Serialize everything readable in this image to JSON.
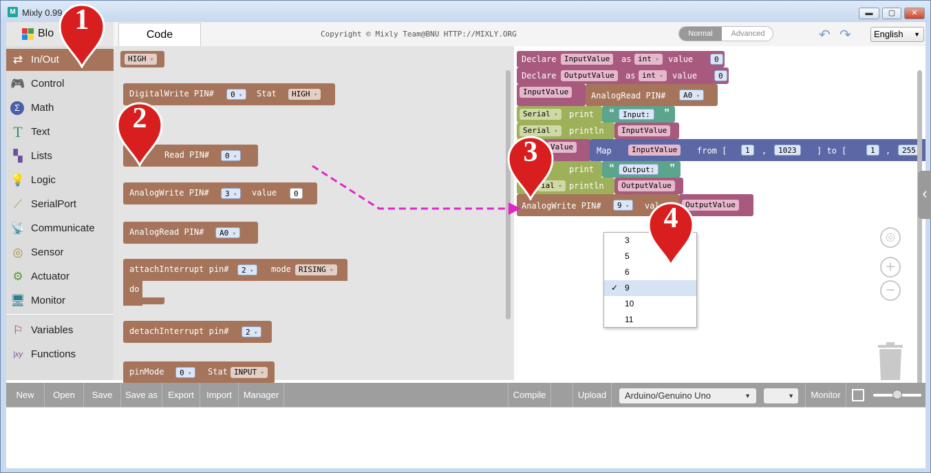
{
  "window": {
    "title": "Mixly 0.99",
    "min": "▬",
    "max": "▢",
    "close": "✕"
  },
  "header": {
    "tab_blocks": "Blo",
    "tab_code": "Code",
    "copyright": "Copyright © Mixly Team@BNU HTTP://MIXLY.ORG",
    "mode_normal": "Normal",
    "mode_advanced": "Advanced",
    "language": "English"
  },
  "toolbox": {
    "categories": [
      {
        "label": "In/Out",
        "icon": "swap-arrows-icon"
      },
      {
        "label": "Control",
        "icon": "gamepad-icon"
      },
      {
        "label": "Math",
        "icon": "sigma-icon"
      },
      {
        "label": "Text",
        "icon": "text-t-icon"
      },
      {
        "label": "Lists",
        "icon": "lists-icon"
      },
      {
        "label": "Logic",
        "icon": "bulb-icon"
      },
      {
        "label": "SerialPort",
        "icon": "serial-cable-icon"
      },
      {
        "label": "Communicate",
        "icon": "satellite-icon"
      },
      {
        "label": "Sensor",
        "icon": "sensor-icon"
      },
      {
        "label": "Actuator",
        "icon": "actuator-icon"
      },
      {
        "label": "Monitor",
        "icon": "monitor-icon"
      },
      {
        "label": "Variables",
        "icon": "variables-icon"
      },
      {
        "label": "Functions",
        "icon": "functions-icon"
      }
    ]
  },
  "flyout": {
    "high": "HIGH",
    "dw_label": "DigitalWrite PIN#",
    "dw_pin": "0",
    "dw_stat": "Stat",
    "dw_val": "HIGH",
    "dr_label": "Read PIN#",
    "dr_pin": "0",
    "aw_label": "AnalogWrite PIN#",
    "aw_pin": "3",
    "aw_value": "value",
    "aw_num": "0",
    "ar_label": "AnalogRead PIN#",
    "ar_pin": "A0",
    "ai_label": "attachInterrupt pin#",
    "ai_pin": "2",
    "ai_mode": "mode",
    "ai_mode_val": "RISING",
    "ai_do": "do",
    "di_label": "detachInterrupt pin#",
    "di_pin": "2",
    "pm_label": "pinMode",
    "pm_pin": "0",
    "pm_stat": "Stat",
    "pm_val": "INPUT"
  },
  "workspace": {
    "decl1": "Declare",
    "decl1_var": "InputValue",
    "decl1_as": "as",
    "decl1_type": "int",
    "decl1_value": "value",
    "decl1_num": "0",
    "decl2": "Declare",
    "decl2_var": "OutputValue",
    "decl2_as": "as",
    "decl2_type": "int",
    "decl2_value": "value",
    "decl2_num": "0",
    "set_in": "InputValue",
    "set_in_read": "AnalogRead PIN#",
    "set_in_pin": "A0",
    "s1_serial": "Serial",
    "s1_print": "print",
    "s1_text": "Input:",
    "s2_serial": "Serial",
    "s2_println": "println",
    "s2_var": "InputValue",
    "set_out": "Value",
    "map": "Map",
    "map_var": "InputValue",
    "map_from": "from [",
    "map_a": "1",
    "map_comma": ",",
    "map_b": "1023",
    "map_to": "] to [",
    "map_c": "1",
    "map_d": "255",
    "s3_print": "print",
    "s3_text": "Output:",
    "s4_serial": "ial",
    "s4_println": "println",
    "s4_var": "OutputValue",
    "aw_label": "AnalogWrite PIN#",
    "aw_pin": "9",
    "aw_value": "val",
    "aw_var": "OutputValue"
  },
  "pin_dropdown": {
    "options": [
      "3",
      "5",
      "6",
      "9",
      "10",
      "11"
    ],
    "selected": "9",
    "check": "✓"
  },
  "markers": [
    "1",
    "2",
    "3",
    "4"
  ],
  "bottombar": {
    "new": "New",
    "open": "Open",
    "save": "Save",
    "save_as": "Save as",
    "export": "Export",
    "import": "Import",
    "manager": "Manager",
    "compile": "Compile",
    "upload": "Upload",
    "board": "Arduino/Genuino Uno",
    "monitor": "Monitor"
  },
  "colors": {
    "inout_block": "#a5745a",
    "variable_block": "#a8597e",
    "serial_block": "#9eb05a",
    "text_block": "#5ba58c",
    "math_block": "#5c68a6",
    "marker_red": "#d81e1e",
    "arrow": "#e024c8"
  }
}
